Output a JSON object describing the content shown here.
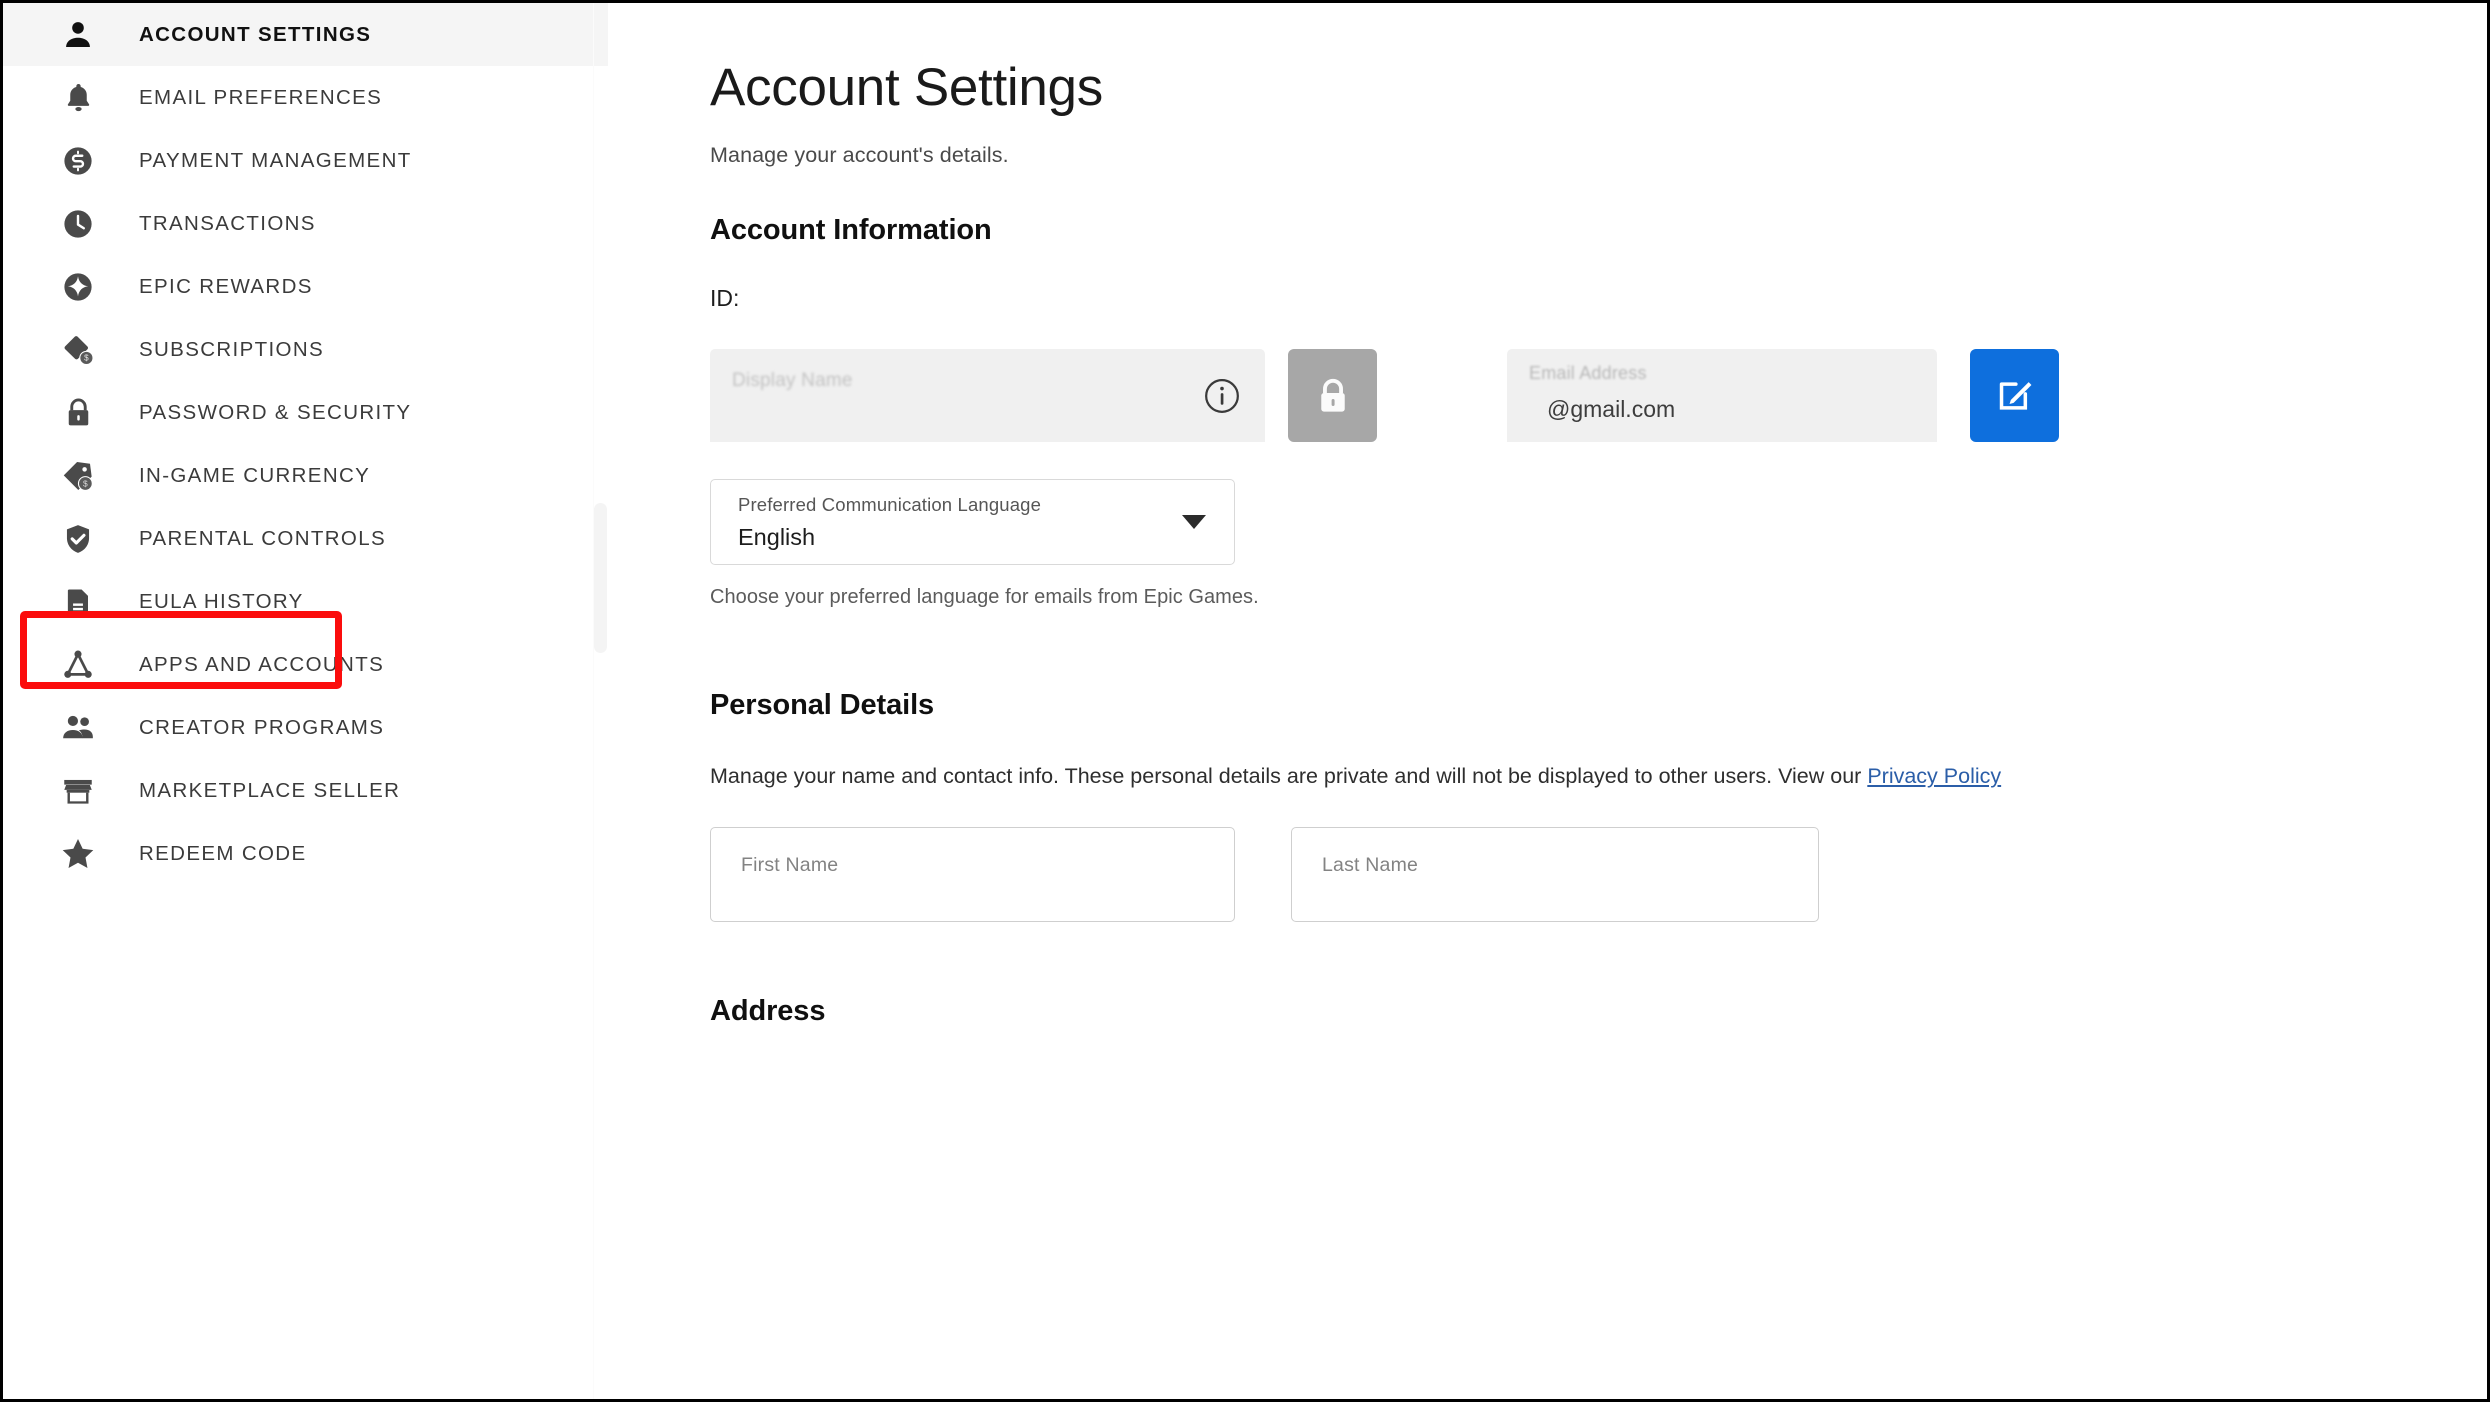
{
  "sidebar": {
    "items": [
      {
        "label": "ACCOUNT SETTINGS",
        "icon": "person-icon",
        "active": true
      },
      {
        "label": "EMAIL PREFERENCES",
        "icon": "bell-icon",
        "active": false
      },
      {
        "label": "PAYMENT MANAGEMENT",
        "icon": "dollar-coin-icon",
        "active": false
      },
      {
        "label": "TRANSACTIONS",
        "icon": "clock-icon",
        "active": false
      },
      {
        "label": "EPIC REWARDS",
        "icon": "sparkle-icon",
        "active": false
      },
      {
        "label": "SUBSCRIPTIONS",
        "icon": "subscription-icon",
        "active": false
      },
      {
        "label": "PASSWORD & SECURITY",
        "icon": "lock-icon",
        "active": false
      },
      {
        "label": "IN-GAME CURRENCY",
        "icon": "price-tag-coin-icon",
        "active": false
      },
      {
        "label": "PARENTAL CONTROLS",
        "icon": "shield-check-icon",
        "active": false
      },
      {
        "label": "EULA HISTORY",
        "icon": "document-icon",
        "active": false
      },
      {
        "label": "APPS AND ACCOUNTS",
        "icon": "network-icon",
        "active": false
      },
      {
        "label": "CREATOR PROGRAMS",
        "icon": "people-icon",
        "active": false
      },
      {
        "label": "MARKETPLACE SELLER",
        "icon": "storefront-icon",
        "active": false
      },
      {
        "label": "REDEEM CODE",
        "icon": "star-icon",
        "active": false
      }
    ],
    "highlight": {
      "target": "PASSWORD & SECURITY",
      "color": "#fb0d0d"
    }
  },
  "main": {
    "page_title": "Account Settings",
    "page_subtitle": "Manage your account's details.",
    "account_information": {
      "heading": "Account Information",
      "id_label": "ID:",
      "id_value": "",
      "display_name": {
        "label": "Display Name",
        "value": "",
        "info_icon": "info-icon",
        "lock_button_icon": "lock-icon"
      },
      "email": {
        "label": "Email Address",
        "value": "@gmail.com",
        "edit_button_icon": "edit-pencil-icon",
        "edit_button_color": "#0e6fdd"
      },
      "language": {
        "label": "Preferred Communication Language",
        "value": "English",
        "helper": "Choose your preferred language for emails from Epic Games.",
        "caret_icon": "chevron-down-icon"
      }
    },
    "personal_details": {
      "heading": "Personal Details",
      "description_before_link": "Manage your name and contact info. These personal details are private and will not be displayed to other users. View our ",
      "link_text": "Privacy Policy",
      "first_name": {
        "label": "First Name",
        "value": ""
      },
      "last_name": {
        "label": "Last Name",
        "value": ""
      }
    },
    "address": {
      "heading": "Address"
    }
  }
}
